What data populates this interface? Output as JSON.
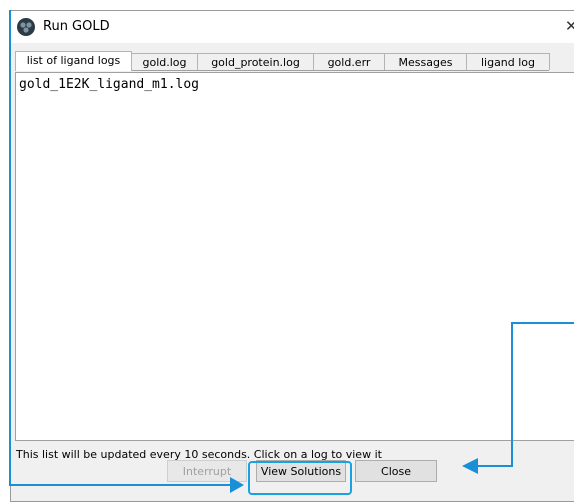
{
  "window": {
    "title": "Run GOLD",
    "close_symbol": "✕",
    "icon": "gold-app-icon"
  },
  "tabs": [
    {
      "label": "list of ligand logs",
      "active": true
    },
    {
      "label": "gold.log",
      "active": false
    },
    {
      "label": "gold_protein.log",
      "active": false
    },
    {
      "label": "gold.err",
      "active": false
    },
    {
      "label": "Messages",
      "active": false
    },
    {
      "label": "ligand log",
      "active": false
    }
  ],
  "content": {
    "log_items": [
      "gold_1E2K_ligand_m1.log"
    ]
  },
  "status_text": "This list will be updated every 10 seconds.  Click on a log to view it",
  "buttons": {
    "interrupt": "Interrupt",
    "view_solutions": "View Solutions",
    "close": "Close"
  },
  "annotation_color": "#1a8fd6"
}
